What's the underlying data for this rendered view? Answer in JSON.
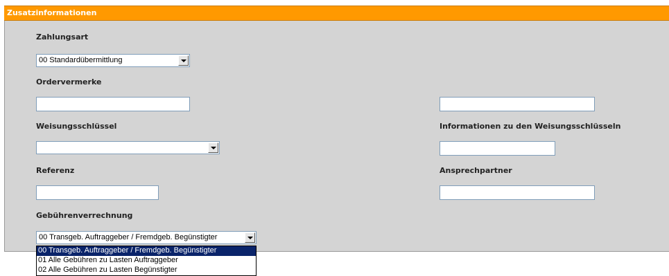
{
  "panel": {
    "title": "Zusatzinformationen"
  },
  "fields": {
    "zahlungsart": {
      "label": "Zahlungsart",
      "value": "00 Standardübermittlung"
    },
    "ordervermerke": {
      "label": "Ordervermerke",
      "value": "",
      "value2": ""
    },
    "weisungsschluessel": {
      "label": "Weisungsschlüssel",
      "value": ""
    },
    "informationen": {
      "label": "Informationen zu den Weisungsschlüsseln",
      "value": ""
    },
    "referenz": {
      "label": "Referenz",
      "value": ""
    },
    "ansprechpartner": {
      "label": "Ansprechpartner",
      "value": ""
    },
    "gebuehren": {
      "label": "Gebührenverrechnung",
      "value": "00 Transgeb. Auftraggeber / Fremdgeb. Begünstigter",
      "options": [
        "00 Transgeb. Auftraggeber / Fremdgeb. Begünstigter",
        "01 Alle Gebühren zu Lasten Auftraggeber",
        "02 Alle Gebühren zu Lasten Begünstigter"
      ]
    }
  },
  "colors": {
    "header": "#ff9900",
    "panel": "#d4d4d4",
    "selected": "#0a246a"
  }
}
